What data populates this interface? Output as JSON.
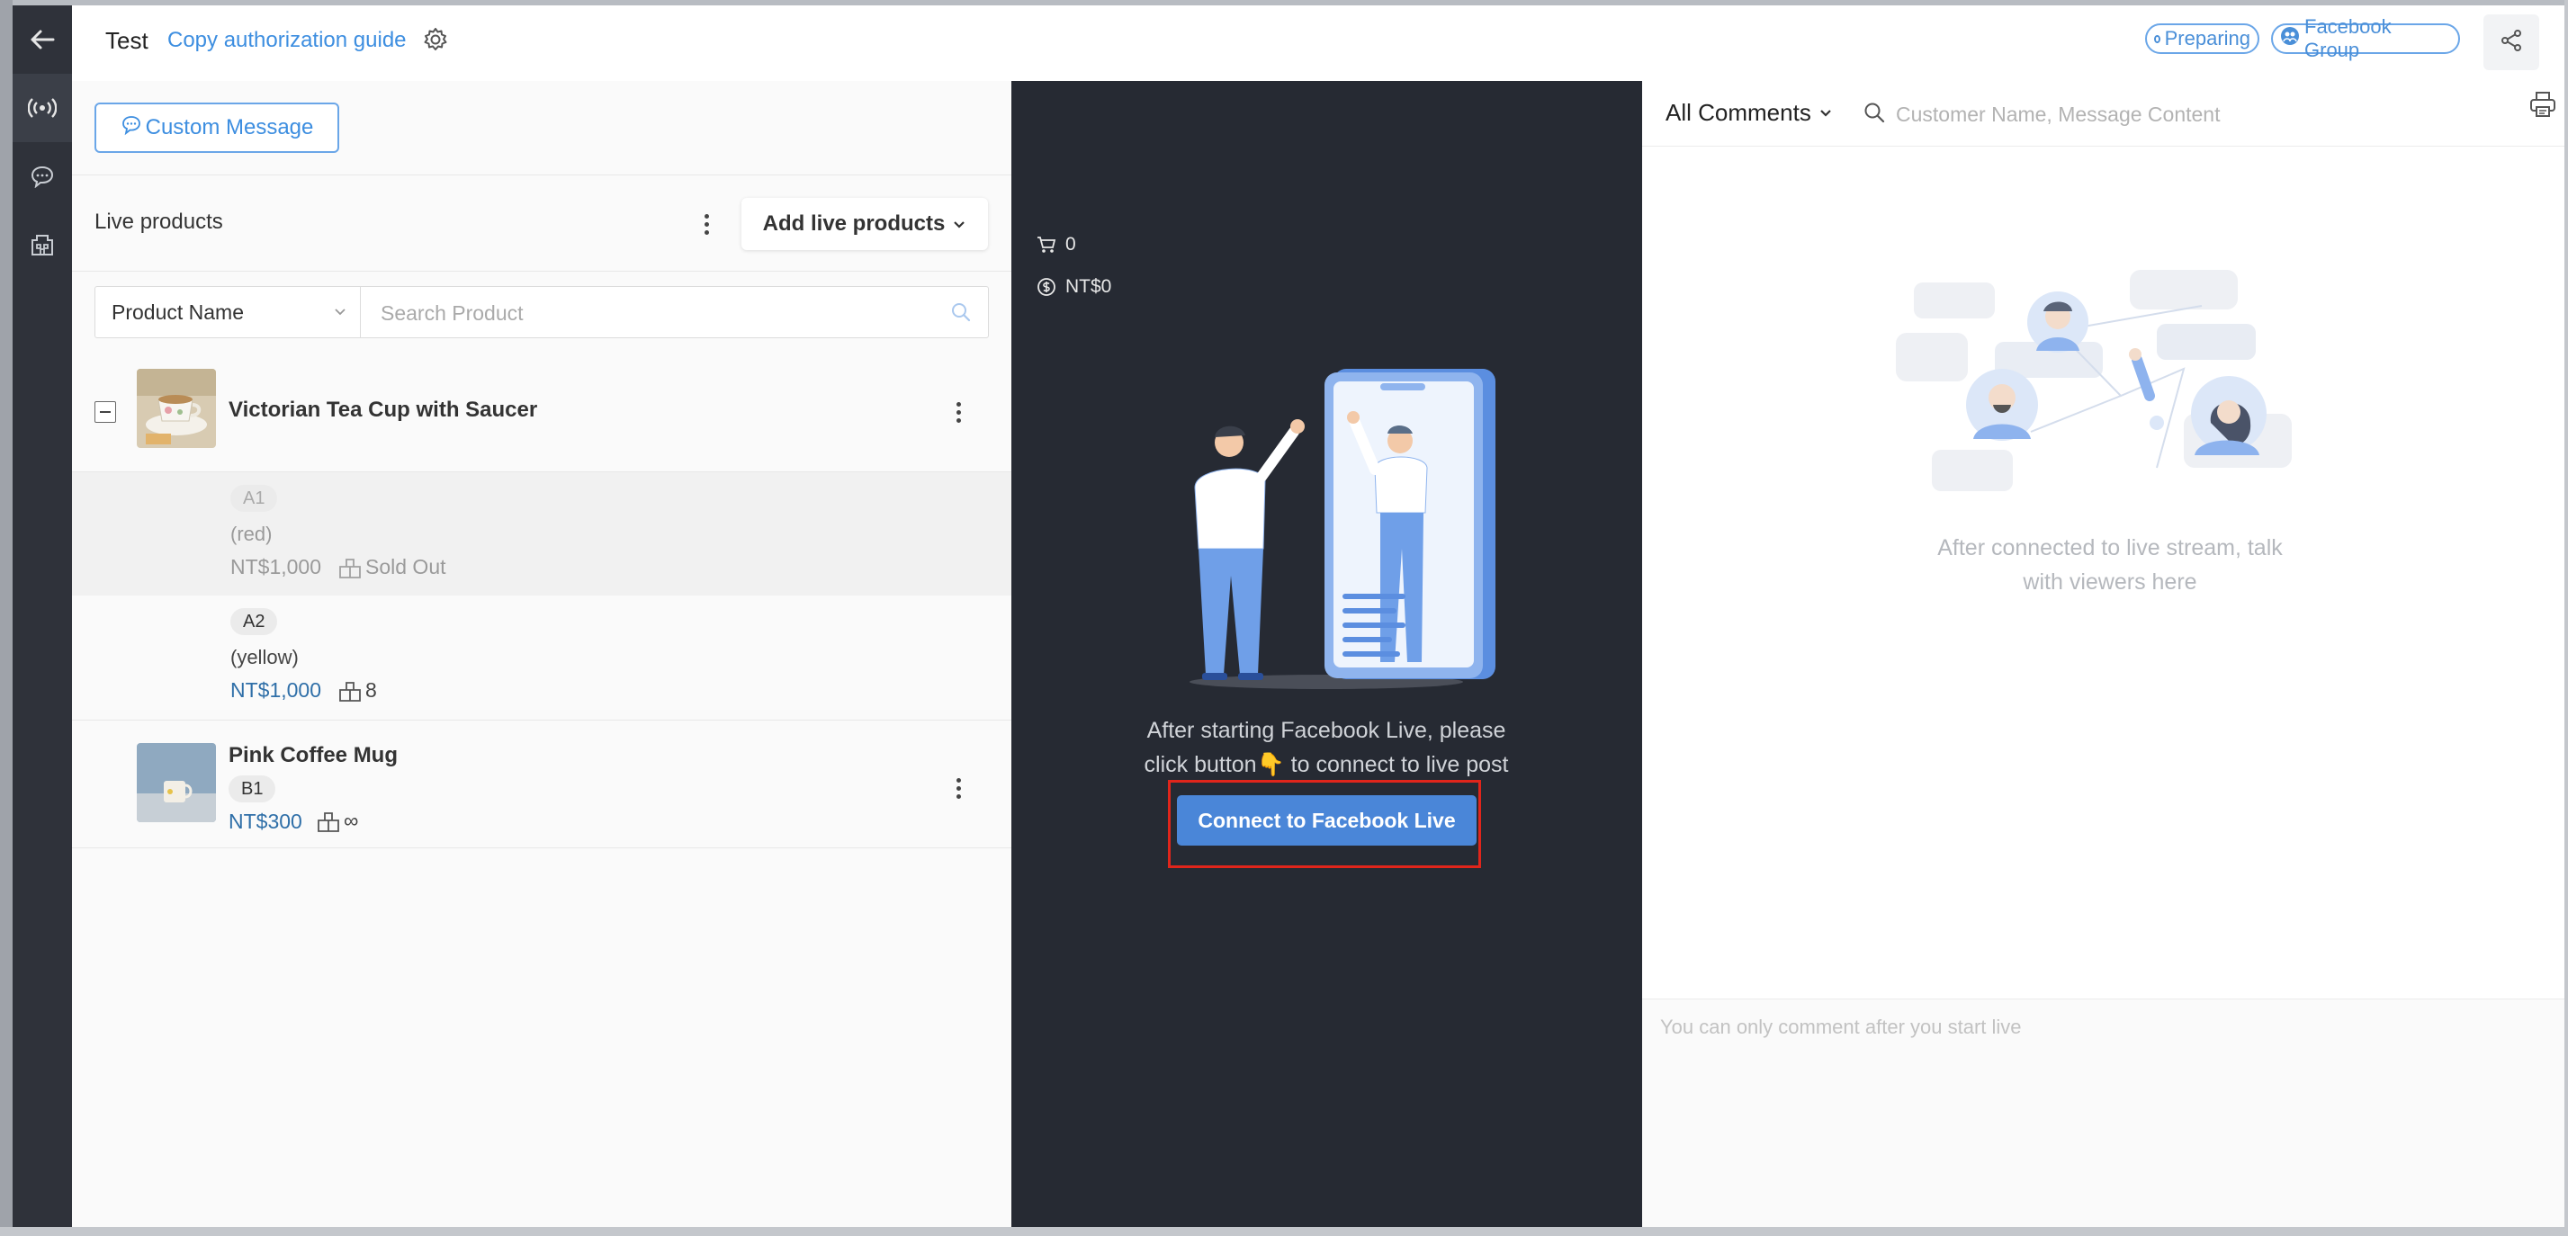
{
  "header": {
    "title": "Test",
    "guide_link": "Copy authorization guide",
    "status_badge": "Preparing",
    "channel_badge": "Facebook Group"
  },
  "rail": {
    "icons": [
      "back-arrow-icon",
      "live-broadcast-icon",
      "chat-bubble-icon",
      "warehouse-icon"
    ]
  },
  "left_panel": {
    "custom_message_label": "Custom Message",
    "live_products_title": "Live products",
    "add_live_products_label": "Add live products",
    "filter_select_value": "Product Name",
    "search_placeholder": "Search Product",
    "products": [
      {
        "name": "Victorian Tea Cup with Saucer",
        "variants": [
          {
            "code": "A1",
            "option": "(red)",
            "price": "NT$1,000",
            "stock": "Sold Out"
          },
          {
            "code": "A2",
            "option": "(yellow)",
            "price": "NT$1,000",
            "stock": "8"
          }
        ]
      },
      {
        "name": "Pink Coffee Mug",
        "code": "B1",
        "price": "NT$300",
        "stock": "∞"
      }
    ]
  },
  "center_panel": {
    "cart_count": "0",
    "revenue": "NT$0",
    "instruction_line1": "After starting Facebook Live, please",
    "instruction_line2": "click button👇 to connect to live post",
    "connect_button_label": "Connect to Facebook Live"
  },
  "right_panel": {
    "filter_label": "All Comments",
    "search_placeholder": "Customer Name, Message Content",
    "empty_line1": "After connected to live stream, talk",
    "empty_line2": "with viewers here",
    "comment_hint": "You can only comment after you start live"
  },
  "colors": {
    "accent_blue": "#3d8ee0",
    "rail_bg": "#2f323a",
    "center_bg": "#262a33",
    "button_blue": "#4a86d8",
    "highlight_red": "#e0251b"
  }
}
